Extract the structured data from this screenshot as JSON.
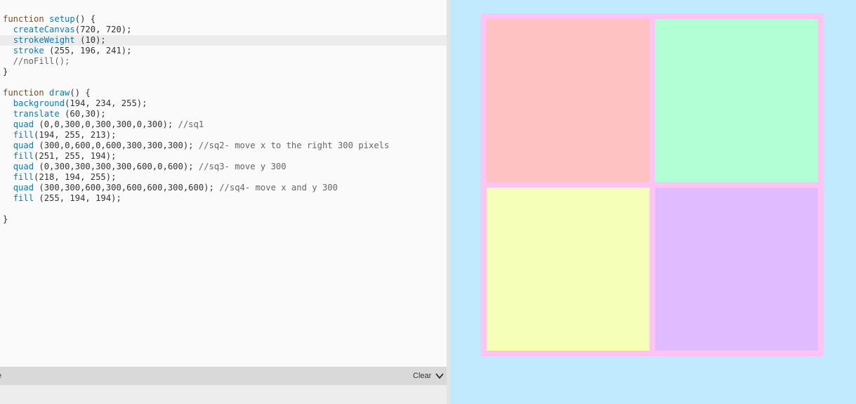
{
  "editor": {
    "active_line": 2,
    "lines": [
      {
        "content": [
          {
            "t": "function",
            "c": "kw"
          },
          {
            "t": " "
          },
          {
            "t": "setup",
            "c": "fn"
          },
          {
            "t": "() {"
          }
        ]
      },
      {
        "content": [
          {
            "t": "  "
          },
          {
            "t": "createCanvas",
            "c": "fn"
          },
          {
            "t": "(720, 720);"
          }
        ]
      },
      {
        "content": [
          {
            "t": "  "
          },
          {
            "t": "strokeWeight",
            "c": "fn"
          },
          {
            "t": " (10);"
          }
        ]
      },
      {
        "content": [
          {
            "t": "  "
          },
          {
            "t": "stroke",
            "c": "fn"
          },
          {
            "t": " (255, 196, 241);"
          }
        ]
      },
      {
        "content": [
          {
            "t": "  //noFill();",
            "c": "cm"
          }
        ]
      },
      {
        "content": [
          {
            "t": "}"
          }
        ]
      },
      {
        "content": []
      },
      {
        "content": [
          {
            "t": "function",
            "c": "kw"
          },
          {
            "t": " "
          },
          {
            "t": "draw",
            "c": "fn"
          },
          {
            "t": "() {"
          }
        ]
      },
      {
        "content": [
          {
            "t": "  "
          },
          {
            "t": "background",
            "c": "fn"
          },
          {
            "t": "(194, 234, 255);"
          }
        ]
      },
      {
        "content": [
          {
            "t": "  "
          },
          {
            "t": "translate",
            "c": "fn"
          },
          {
            "t": " (60,30);"
          }
        ]
      },
      {
        "content": [
          {
            "t": "  "
          },
          {
            "t": "quad",
            "c": "fn"
          },
          {
            "t": " (0,0,300,0,300,300,0,300); "
          },
          {
            "t": "//sq1",
            "c": "cm"
          }
        ]
      },
      {
        "content": [
          {
            "t": "  "
          },
          {
            "t": "fill",
            "c": "fn"
          },
          {
            "t": "(194, 255, 213);"
          }
        ]
      },
      {
        "content": [
          {
            "t": "  "
          },
          {
            "t": "quad",
            "c": "fn"
          },
          {
            "t": " (300,0,600,0,600,300,300,300); "
          },
          {
            "t": "//sq2- move x to the right 300 pixels",
            "c": "cm"
          }
        ]
      },
      {
        "content": [
          {
            "t": "  "
          },
          {
            "t": "fill",
            "c": "fn"
          },
          {
            "t": "(251, 255, 194);"
          }
        ]
      },
      {
        "content": [
          {
            "t": "  "
          },
          {
            "t": "quad",
            "c": "fn"
          },
          {
            "t": " (0,300,300,300,300,600,0,600); "
          },
          {
            "t": "//sq3- move y 300",
            "c": "cm"
          }
        ]
      },
      {
        "content": [
          {
            "t": "  "
          },
          {
            "t": "fill",
            "c": "fn"
          },
          {
            "t": "(218, 194, 255);"
          }
        ]
      },
      {
        "content": [
          {
            "t": "  "
          },
          {
            "t": "quad",
            "c": "fn"
          },
          {
            "t": " (300,300,600,300,600,600,300,600); "
          },
          {
            "t": "//sq4- move x and y 300",
            "c": "cm"
          }
        ]
      },
      {
        "content": [
          {
            "t": "  "
          },
          {
            "t": "fill",
            "c": "fn"
          },
          {
            "t": " (255, 194, 194);"
          }
        ]
      },
      {
        "content": []
      },
      {
        "content": [
          {
            "t": "}"
          }
        ]
      }
    ]
  },
  "console": {
    "left_label": "e",
    "clear_label": "Clear",
    "toggle_icon": "chevron-down-icon"
  },
  "preview": {
    "background_color": "#c2eaff",
    "stroke_color": "#ffc4f1",
    "squares": [
      {
        "name": "sq1",
        "fill": "#ffc2c2"
      },
      {
        "name": "sq2",
        "fill": "#b2ffd5"
      },
      {
        "name": "sq3",
        "fill": "#f5ffb7"
      },
      {
        "name": "sq4",
        "fill": "#e0bbff"
      }
    ]
  },
  "colors": {
    "keyword": "#7a4e25",
    "function": "#0b7cb5",
    "comment": "#666666"
  }
}
